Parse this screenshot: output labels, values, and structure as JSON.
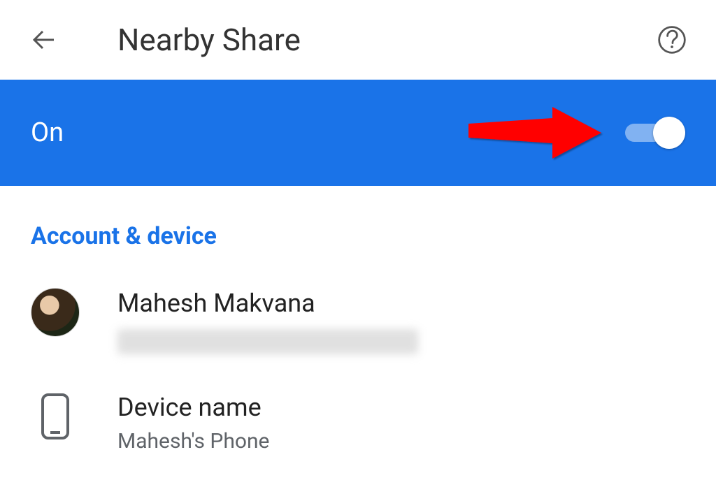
{
  "header": {
    "title": "Nearby Share"
  },
  "toggle": {
    "label": "On",
    "state": "On"
  },
  "section": {
    "heading": "Account & device"
  },
  "account": {
    "name": "Mahesh Makvana"
  },
  "device": {
    "label": "Device name",
    "value": "Mahesh's Phone"
  }
}
